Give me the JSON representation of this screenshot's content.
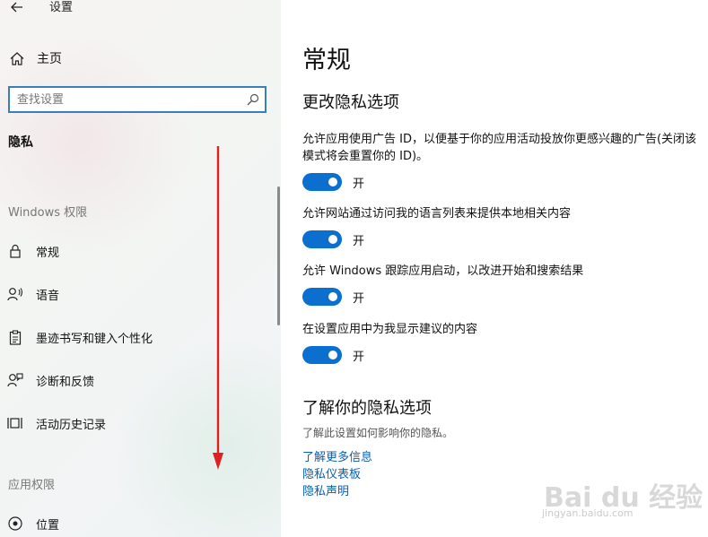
{
  "app": {
    "title": "设置"
  },
  "sidebar": {
    "home_label": "主页",
    "search_placeholder": "查找设置",
    "section_title": "隐私",
    "group_windows": "Windows 权限",
    "items": [
      {
        "label": "常规",
        "icon": "lock-icon"
      },
      {
        "label": "语音",
        "icon": "speech-icon"
      },
      {
        "label": "墨迹书写和键入个性化",
        "icon": "clipboard-icon"
      },
      {
        "label": "诊断和反馈",
        "icon": "feedback-icon"
      },
      {
        "label": "活动历史记录",
        "icon": "timeline-icon"
      }
    ],
    "group_apps": "应用权限",
    "apps_items": [
      {
        "label": "位置",
        "icon": "location-icon"
      }
    ]
  },
  "main": {
    "title": "常规",
    "subtitle": "更改隐私选项",
    "settings": [
      {
        "desc": "允许应用使用广告 ID，以便基于你的应用活动投放你更感兴趣的广告(关闭该模式将会重置你的 ID)。",
        "state": "开",
        "on": true
      },
      {
        "desc": "允许网站通过访问我的语言列表来提供本地相关内容",
        "state": "开",
        "on": true
      },
      {
        "desc": "允许 Windows 跟踪应用启动，以改进开始和搜索结果",
        "state": "开",
        "on": true
      },
      {
        "desc": "在设置应用中为我显示建议的内容",
        "state": "开",
        "on": true
      }
    ],
    "learn_title": "了解你的隐私选项",
    "learn_desc": "了解此设置如何影响你的隐私。",
    "links": [
      "了解更多信息",
      "隐私仪表板",
      "隐私声明"
    ]
  },
  "colors": {
    "accent": "#0a6fcf",
    "link": "#0a5fb4",
    "arrow": "#e02020"
  },
  "watermark": {
    "text": "Bai du 经验",
    "sub": "jingyan.baidu.com"
  }
}
